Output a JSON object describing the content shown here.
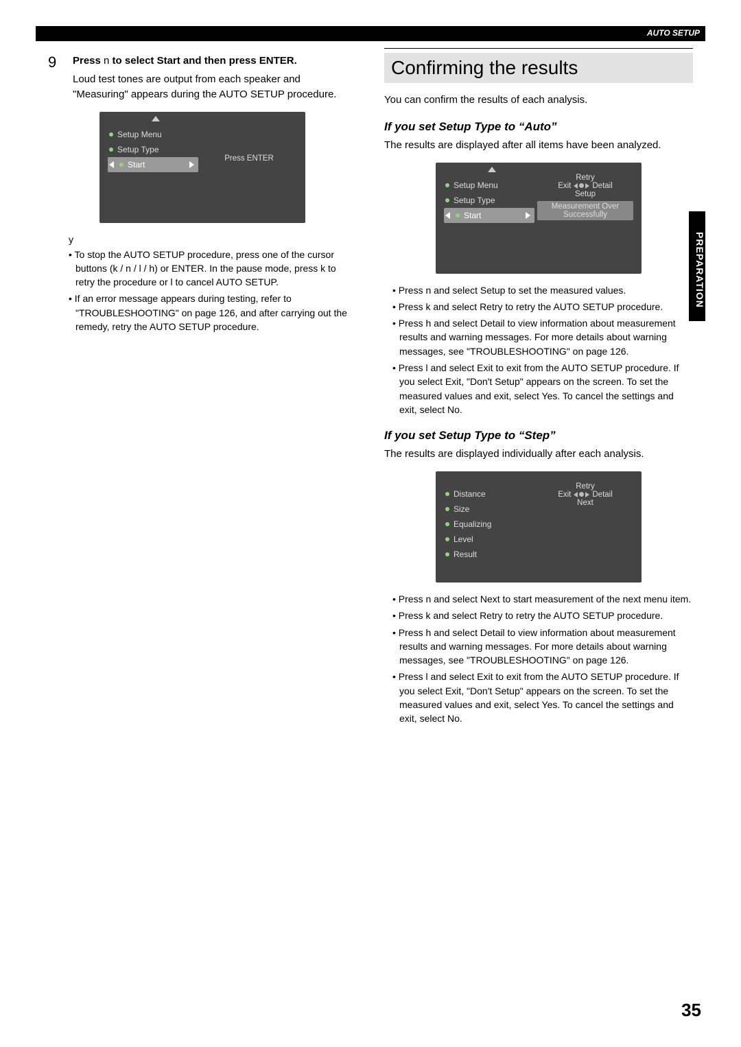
{
  "header": {
    "label": "AUTO SETUP"
  },
  "sidetab": {
    "label": "PREPARATION"
  },
  "page_number": "35",
  "left": {
    "step_num": "9",
    "step_title_prefix": "Press ",
    "step_title_mid": "n",
    "step_title_suffix": " to select Start and then press ENTER.",
    "step_body": "Loud test tones are output from each speaker and \"Measuring\" appears during the AUTO SETUP procedure.",
    "note_icon": "y",
    "bullets": [
      "To stop the AUTO SETUP procedure, press one of the cursor buttons (k / n / l / h) or ENTER. In the pause mode, press k to retry the procedure or l to cancel AUTO SETUP.",
      "If an error message appears during testing, refer to \"TROUBLESHOOTING\" on page 126, and after carrying out the remedy, retry the AUTO SETUP procedure."
    ],
    "osd": {
      "items": [
        "Setup Menu",
        "Setup Type",
        "Start"
      ],
      "highlight_idx": 2,
      "right_single": "Press ENTER"
    }
  },
  "right": {
    "section_title": "Confirming the results",
    "intro": "You can confirm the results of each analysis.",
    "auto": {
      "heading": "If you set Setup Type to “Auto”",
      "body": "The results are displayed after all items have been analyzed.",
      "osd": {
        "items": [
          "Setup Menu",
          "Setup Type",
          "Start"
        ],
        "highlight_idx": 2,
        "panel": {
          "top": "Retry",
          "left": "Exit",
          "right": "Detail",
          "bottom": "Setup",
          "msg1": "Measurement Over",
          "msg2": "Successfully"
        }
      },
      "bullets": [
        "Press n and select Setup to set the measured values.",
        "Press k and select Retry to retry the AUTO SETUP procedure.",
        "Press h and select Detail to view information about measurement results and warning messages. For more details about warning messages, see \"TROUBLESHOOTING\" on page 126.",
        "Press l and select Exit to exit from the AUTO SETUP procedure. If you select Exit, \"Don't Setup\" appears on the screen. To set the measured values and exit, select Yes. To cancel the settings and exit, select No."
      ]
    },
    "step": {
      "heading": "If you set Setup Type to “Step”",
      "body": "The results are displayed individually after each analysis.",
      "osd": {
        "items": [
          "Distance",
          "Size",
          "Equalizing",
          "Level",
          "Result"
        ],
        "no_highlight": true,
        "panel": {
          "top": "Retry",
          "left": "Exit",
          "right": "Detail",
          "bottom": "Next"
        }
      },
      "bullets": [
        "Press n and select Next to start measurement of the next menu item.",
        "Press k and select Retry to retry the AUTO SETUP procedure.",
        "Press h and select Detail to view information about measurement results and warning messages. For more details about warning messages, see \"TROUBLESHOOTING\" on page 126.",
        "Press l and select Exit to exit from the AUTO SETUP procedure. If you select Exit, \"Don't Setup\" appears on the screen. To set the measured values and exit, select Yes. To cancel the settings and exit, select No."
      ]
    }
  }
}
